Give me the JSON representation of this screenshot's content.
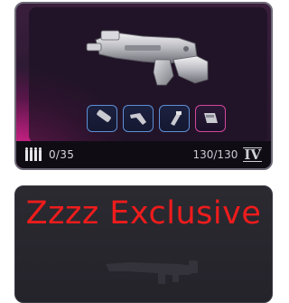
{
  "card": {
    "ammo": "0/35",
    "durability": "130/130",
    "tier": "IV",
    "attachments": [
      {
        "icon": "muzzle-icon",
        "rarity": "blue"
      },
      {
        "icon": "stock-icon",
        "rarity": "blue"
      },
      {
        "icon": "grip-icon",
        "rarity": "blue"
      },
      {
        "icon": "magazine-icon",
        "rarity": "pink"
      }
    ],
    "accent_color": "#e0308f"
  },
  "locked_card": {
    "title": "Zzzz Exclusive",
    "title_color": "#ee1c1c"
  }
}
